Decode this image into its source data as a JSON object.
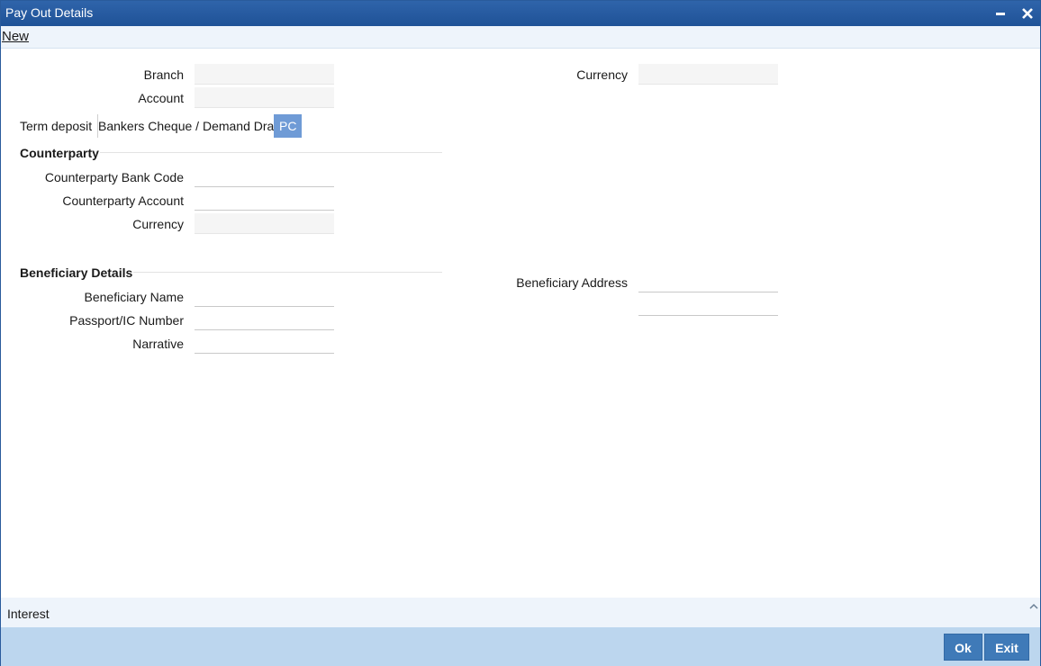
{
  "window": {
    "title": "Pay Out Details"
  },
  "menu": {
    "new_label": "New"
  },
  "header_fields": {
    "branch_label": "Branch",
    "account_label": "Account",
    "currency_label": "Currency"
  },
  "tabs": [
    {
      "label": "Term deposit"
    },
    {
      "label": "Bankers Cheque / Demand Draft"
    },
    {
      "label": "PC",
      "active": true
    }
  ],
  "counterparty": {
    "heading": "Counterparty",
    "bank_code_label": "Counterparty Bank Code",
    "account_label": "Counterparty Account",
    "currency_label": "Currency"
  },
  "beneficiary": {
    "heading": "Beneficiary Details",
    "name_label": "Beneficiary Name",
    "passport_label": "Passport/IC Number",
    "narrative_label": "Narrative",
    "address_label": "Beneficiary Address"
  },
  "interest": {
    "label": "Interest"
  },
  "footer": {
    "ok_label": "Ok",
    "exit_label": "Exit"
  },
  "colors": {
    "titlebar": "#1f5297",
    "active_tab": "#6f9bd6",
    "footer": "#bcd6ee",
    "button": "#3f7ab8"
  },
  "icons": {
    "minimize": "minimize-icon",
    "close": "close-icon",
    "collapse": "chevron-up-icon"
  }
}
